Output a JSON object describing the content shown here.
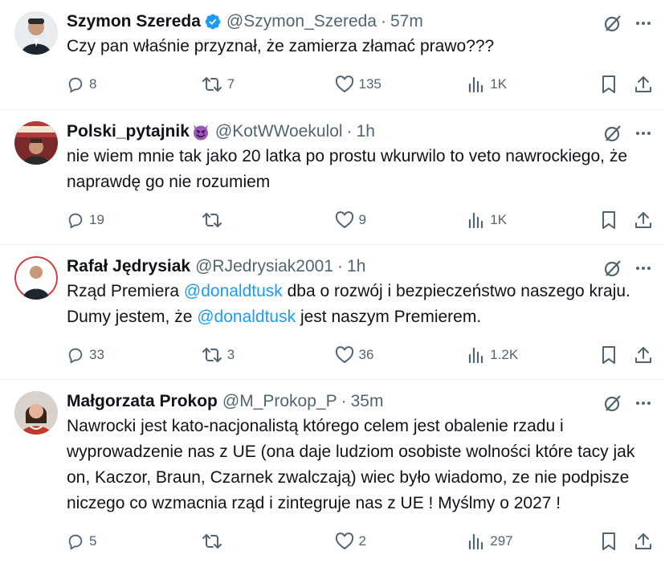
{
  "tweets": [
    {
      "name": "Szymon Szereda",
      "verified": true,
      "emoji": "",
      "handle": "@Szymon_Szereda",
      "sep": "·",
      "time": "57m",
      "text_parts": [
        {
          "t": "Czy pan właśnie przyznał, że zamierza złamać prawo???",
          "m": false
        }
      ],
      "replies": "8",
      "retweets": "7",
      "likes": "135",
      "views": "1K"
    },
    {
      "name": "Polski_pytajnik",
      "verified": false,
      "emoji": "smiling-imp-emoji",
      "handle": "@KotWWoekulol",
      "sep": "·",
      "time": "1h",
      "text_parts": [
        {
          "t": "nie wiem mnie tak jako 20 latka po prostu wkurwilo to veto nawrockiego, że naprawdę go nie rozumiem",
          "m": false
        }
      ],
      "replies": "19",
      "retweets": "",
      "likes": "9",
      "views": "1K"
    },
    {
      "name": "Rafał Jędrysiak",
      "verified": false,
      "emoji": "",
      "handle": "@RJedrysiak2001",
      "sep": "·",
      "time": "1h",
      "text_parts": [
        {
          "t": "Rząd Premiera ",
          "m": false
        },
        {
          "t": "@donaldtusk",
          "m": true
        },
        {
          "t": " dba o rozwój i bezpieczeństwo naszego kraju. Dumy jestem, że ",
          "m": false
        },
        {
          "t": "@donaldtusk",
          "m": true
        },
        {
          "t": " jest naszym Premierem.",
          "m": false
        }
      ],
      "replies": "33",
      "retweets": "3",
      "likes": "36",
      "views": "1.2K"
    },
    {
      "name": "Małgorzata Prokop",
      "verified": false,
      "emoji": "",
      "handle": "@M_Prokop_P",
      "sep": "·",
      "time": "35m",
      "text_parts": [
        {
          "t": "Nawrocki jest kato-nacjonalistą którego celem jest obalenie rzadu i wyprowadzenie nas z UE (ona daje ludziom osobiste wolności które tacy jak on, Kaczor, Braun, Czarnek zwalczają) wiec było wiadomo, ze nie podpisze niczego co wzmacnia rząd i zintegruje nas z UE ! Myślmy o 2027 !",
          "m": false
        }
      ],
      "replies": "5",
      "retweets": "",
      "likes": "2",
      "views": "297"
    }
  ],
  "icons": {
    "grok": "grok-icon",
    "more": "more-icon",
    "reply": "reply-icon",
    "retweet": "retweet-icon",
    "like": "like-icon",
    "views": "views-icon",
    "bookmark": "bookmark-icon",
    "share": "share-icon",
    "verified": "verified-badge-icon"
  },
  "colors": {
    "text": "#0f1419",
    "secondary": "#536471",
    "link": "#1d9bf0",
    "verified": "#1d9bf0",
    "divider": "#eff3f4"
  }
}
